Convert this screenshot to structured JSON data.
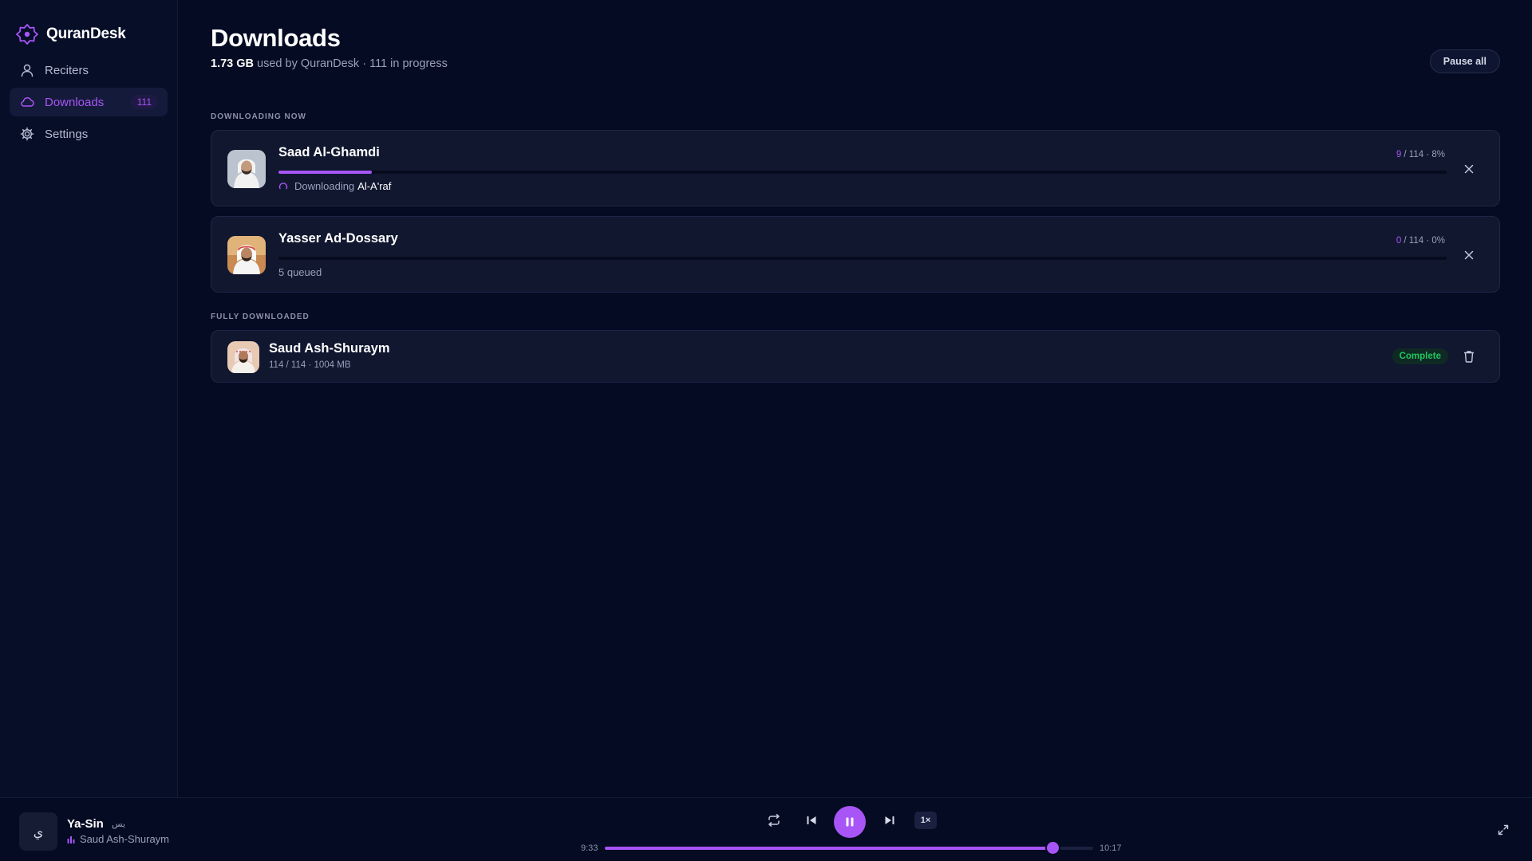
{
  "app": {
    "name": "QuranDesk",
    "accent": "#a855f7"
  },
  "sidebar": {
    "items": [
      {
        "label": "Reciters",
        "icon": "user-icon"
      },
      {
        "label": "Downloads",
        "icon": "cloud-icon",
        "badge": "111",
        "active": true
      },
      {
        "label": "Settings",
        "icon": "gear-icon"
      }
    ]
  },
  "page": {
    "title": "Downloads",
    "storage_used": "1.73 GB",
    "storage_text": "used by QuranDesk",
    "in_progress_text": "· 111 in progress",
    "pause_all_label": "Pause all"
  },
  "sections": {
    "downloading_now": "DOWNLOADING NOW",
    "fully_downloaded": "FULLY DOWNLOADED"
  },
  "downloading": [
    {
      "name": "Saad Al-Ghamdi",
      "done": "9",
      "total_text": "/ 114 · 8%",
      "progress": 0.08,
      "status_prefix": "Downloading",
      "status_item": "Al-A'raf"
    },
    {
      "name": "Yasser Ad-Dossary",
      "done": "0",
      "total_text": "/ 114 · 0%",
      "progress": 0.0,
      "status_prefix": "5 queued"
    }
  ],
  "completed": [
    {
      "name": "Saud Ash-Shuraym",
      "meta": "114 / 114 · 1004 MB",
      "badge": "Complete"
    }
  ],
  "player": {
    "art_glyph": "ي",
    "title": "Ya-Sin",
    "title_arabic": "يس",
    "artist": "Saud Ash-Shuraym",
    "elapsed": "9:33",
    "duration": "10:17",
    "progress": 0.93,
    "speed": "1×"
  }
}
